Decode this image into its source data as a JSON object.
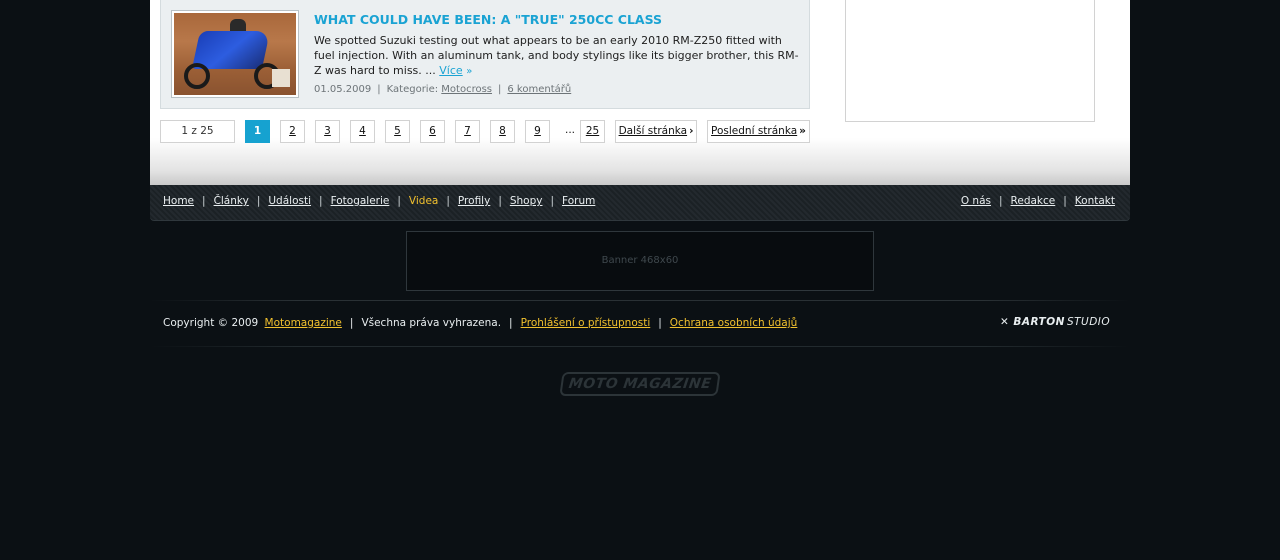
{
  "article": {
    "title": "WHAT COULD HAVE BEEN: A \"TRUE\" 250CC CLASS",
    "text": "We spotted Suzuki testing out what appears to be an early 2010 RM-Z250 fitted with fuel injection. With an aluminum tank, and body stylings like its bigger brother, this RM-Z was hard to miss.",
    "ellipsis": " ... ",
    "more_label": "Více",
    "more_arrow": "»",
    "date": "01.05.2009",
    "category_label": "Kategorie:",
    "category": "Motocross",
    "comments": "6 komentářů"
  },
  "pager": {
    "info": "1 z 25",
    "current": "1",
    "pages": [
      "2",
      "3",
      "4",
      "5",
      "6",
      "7",
      "8",
      "9"
    ],
    "dots": "...",
    "last_page": "25",
    "next_label": "Další stránka",
    "next_arrow": "›",
    "last_label": "Poslední stránka",
    "last_arrow": "»"
  },
  "nav": {
    "left": [
      "Home",
      "Články",
      "Události",
      "Fotogalerie",
      "Videa",
      "Profily",
      "Shopy",
      "Forum"
    ],
    "active": "Videa",
    "right": [
      "O nás",
      "Redakce",
      "Kontakt"
    ],
    "separator": "|"
  },
  "banner": {
    "label": "Banner 468x60"
  },
  "footer": {
    "copyright_prefix": "Copyright © 2009",
    "site_link": "Motomagazine",
    "rights": "Všechna práva vyhrazena.",
    "accessibility": "Prohlášení o přístupnosti",
    "privacy": "Ochrana osobních údajů",
    "studio_bold": "BARTON",
    "studio_rest": "STUDIO"
  },
  "logo": {
    "text": "MOTO MAGAZINE"
  },
  "colors": {
    "accent_blue": "#16a2d0",
    "active_yellow": "#f2c12e",
    "background": "#0b1014"
  }
}
